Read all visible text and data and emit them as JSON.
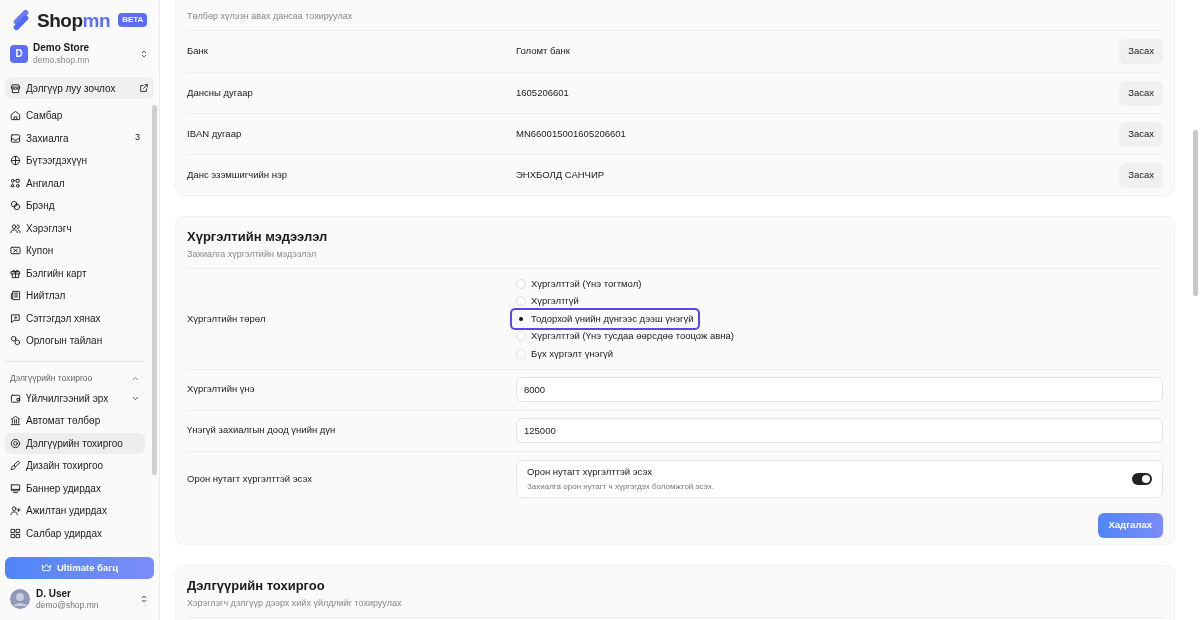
{
  "brand": {
    "name": "Shop",
    "name_accent": "mn",
    "badge": "BETA"
  },
  "store": {
    "initial": "D",
    "name": "Demo Store",
    "domain": "demo.shop.mn"
  },
  "visit_store": "Дэлгүүр луу зочлох",
  "nav": [
    {
      "label": "Самбар",
      "selected": false
    },
    {
      "label": "Захиалга",
      "count": "3",
      "selected": false
    },
    {
      "label": "Бүтээгдэхүүн",
      "selected": false
    },
    {
      "label": "Ангилал",
      "selected": false
    },
    {
      "label": "Брэнд",
      "selected": false
    },
    {
      "label": "Хэрэглэгч",
      "selected": false
    },
    {
      "label": "Купон",
      "selected": false
    },
    {
      "label": "Бэлгийн карт",
      "selected": false
    },
    {
      "label": "Нийтлэл",
      "selected": false
    },
    {
      "label": "Сэтгэгдэл хянах",
      "selected": false
    },
    {
      "label": "Орлогын тайлан",
      "selected": false
    }
  ],
  "settings_group": {
    "label": "Дэлгүүрийн тохиргоо",
    "expanded": true,
    "items": [
      {
        "label": "Үйлчилгээний эрх",
        "kind": "group",
        "expanded": false,
        "selected": false
      },
      {
        "label": "Автомат төлбөр",
        "kind": "link",
        "selected": false
      },
      {
        "label": "Дэлгүүрийн тохиргоо",
        "kind": "link",
        "selected": true
      },
      {
        "label": "Дизайн тохиргоо",
        "kind": "link",
        "selected": false
      },
      {
        "label": "Баннер удирдах",
        "kind": "link",
        "selected": false
      },
      {
        "label": "Ажилтан удирдах",
        "kind": "link",
        "selected": false
      },
      {
        "label": "Салбар удирдах",
        "kind": "link",
        "selected": false
      }
    ]
  },
  "upgrade": "Ultimate багц",
  "user": {
    "name": "D. User",
    "email": "demo@shop.mn"
  },
  "bank_section": {
    "subtitle": "Төлбөр хүлээн авах дансаа тохируулах",
    "rows": [
      {
        "label": "Банк",
        "value": "Голомт банк",
        "action": "Засах"
      },
      {
        "label": "Дансны дугаар",
        "value": "1605206601",
        "action": "Засах"
      },
      {
        "label": "IBAN дугаар",
        "value": "MN660015001605206601",
        "action": "Засах"
      },
      {
        "label": "Данс эзэмшигчийн нэр",
        "value": "ЭНХБОЛД САНЧИР",
        "action": "Засах"
      }
    ]
  },
  "delivery_section": {
    "title": "Хүргэлтийн мэдээлэл",
    "subtitle": "Захиалга хүргэлтийн мэдээлэл",
    "type_field": {
      "label": "Хүргэлтийн төрөл",
      "options": [
        {
          "label": "Хүргэлттэй (Үнэ тогтмол)",
          "selected": false
        },
        {
          "label": "Хүргэлтгүй",
          "selected": false
        },
        {
          "label": "Тодорхой үнийн дүнгээс дээш үнэгүй",
          "selected": true
        },
        {
          "label": "Хүргэлттэй (Үнэ тусдаа өөрсдөө тооцож авна)",
          "selected": false
        },
        {
          "label": "Бүх хүргэлт үнэгүй",
          "selected": false
        }
      ]
    },
    "fields": [
      {
        "label": "Хүргэлтийн үнэ",
        "value": "8000"
      },
      {
        "label": "Үнэгүй захиалгын доод үнийн дүн",
        "value": "125000"
      }
    ],
    "rural": {
      "label": "Орон нутагт хүргэлттэй эсэх",
      "title": "Орон нутагт хүргэлттэй эсэх",
      "description": "Захиалга орон нутагт ч хүргэгдэх боломжтой эсэх.",
      "on": true
    },
    "save": "Хадгалах"
  },
  "store_settings": {
    "title": "Дэлгүүрийн тохиргоо",
    "subtitle": "Хэрэглэгч дэлгүүр дээрх хийх үйлдлийг тохируулах"
  }
}
